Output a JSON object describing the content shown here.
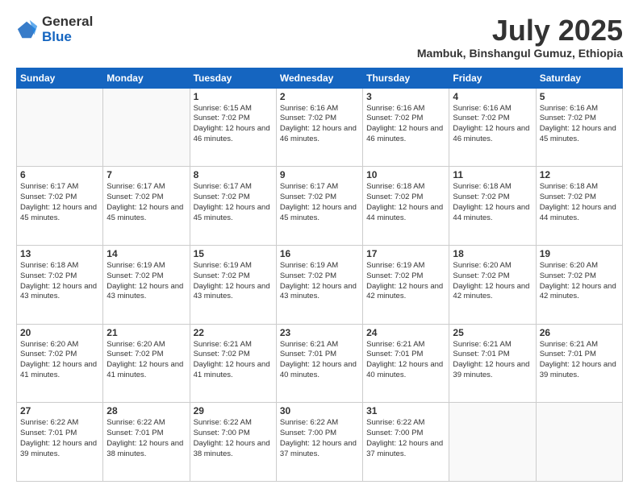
{
  "logo": {
    "general": "General",
    "blue": "Blue"
  },
  "title": "July 2025",
  "subtitle": "Mambuk, Binshangul Gumuz, Ethiopia",
  "days_of_week": [
    "Sunday",
    "Monday",
    "Tuesday",
    "Wednesday",
    "Thursday",
    "Friday",
    "Saturday"
  ],
  "weeks": [
    [
      {
        "day": "",
        "info": ""
      },
      {
        "day": "",
        "info": ""
      },
      {
        "day": "1",
        "info": "Sunrise: 6:15 AM\nSunset: 7:02 PM\nDaylight: 12 hours and 46 minutes."
      },
      {
        "day": "2",
        "info": "Sunrise: 6:16 AM\nSunset: 7:02 PM\nDaylight: 12 hours and 46 minutes."
      },
      {
        "day": "3",
        "info": "Sunrise: 6:16 AM\nSunset: 7:02 PM\nDaylight: 12 hours and 46 minutes."
      },
      {
        "day": "4",
        "info": "Sunrise: 6:16 AM\nSunset: 7:02 PM\nDaylight: 12 hours and 46 minutes."
      },
      {
        "day": "5",
        "info": "Sunrise: 6:16 AM\nSunset: 7:02 PM\nDaylight: 12 hours and 45 minutes."
      }
    ],
    [
      {
        "day": "6",
        "info": "Sunrise: 6:17 AM\nSunset: 7:02 PM\nDaylight: 12 hours and 45 minutes."
      },
      {
        "day": "7",
        "info": "Sunrise: 6:17 AM\nSunset: 7:02 PM\nDaylight: 12 hours and 45 minutes."
      },
      {
        "day": "8",
        "info": "Sunrise: 6:17 AM\nSunset: 7:02 PM\nDaylight: 12 hours and 45 minutes."
      },
      {
        "day": "9",
        "info": "Sunrise: 6:17 AM\nSunset: 7:02 PM\nDaylight: 12 hours and 45 minutes."
      },
      {
        "day": "10",
        "info": "Sunrise: 6:18 AM\nSunset: 7:02 PM\nDaylight: 12 hours and 44 minutes."
      },
      {
        "day": "11",
        "info": "Sunrise: 6:18 AM\nSunset: 7:02 PM\nDaylight: 12 hours and 44 minutes."
      },
      {
        "day": "12",
        "info": "Sunrise: 6:18 AM\nSunset: 7:02 PM\nDaylight: 12 hours and 44 minutes."
      }
    ],
    [
      {
        "day": "13",
        "info": "Sunrise: 6:18 AM\nSunset: 7:02 PM\nDaylight: 12 hours and 43 minutes."
      },
      {
        "day": "14",
        "info": "Sunrise: 6:19 AM\nSunset: 7:02 PM\nDaylight: 12 hours and 43 minutes."
      },
      {
        "day": "15",
        "info": "Sunrise: 6:19 AM\nSunset: 7:02 PM\nDaylight: 12 hours and 43 minutes."
      },
      {
        "day": "16",
        "info": "Sunrise: 6:19 AM\nSunset: 7:02 PM\nDaylight: 12 hours and 43 minutes."
      },
      {
        "day": "17",
        "info": "Sunrise: 6:19 AM\nSunset: 7:02 PM\nDaylight: 12 hours and 42 minutes."
      },
      {
        "day": "18",
        "info": "Sunrise: 6:20 AM\nSunset: 7:02 PM\nDaylight: 12 hours and 42 minutes."
      },
      {
        "day": "19",
        "info": "Sunrise: 6:20 AM\nSunset: 7:02 PM\nDaylight: 12 hours and 42 minutes."
      }
    ],
    [
      {
        "day": "20",
        "info": "Sunrise: 6:20 AM\nSunset: 7:02 PM\nDaylight: 12 hours and 41 minutes."
      },
      {
        "day": "21",
        "info": "Sunrise: 6:20 AM\nSunset: 7:02 PM\nDaylight: 12 hours and 41 minutes."
      },
      {
        "day": "22",
        "info": "Sunrise: 6:21 AM\nSunset: 7:02 PM\nDaylight: 12 hours and 41 minutes."
      },
      {
        "day": "23",
        "info": "Sunrise: 6:21 AM\nSunset: 7:01 PM\nDaylight: 12 hours and 40 minutes."
      },
      {
        "day": "24",
        "info": "Sunrise: 6:21 AM\nSunset: 7:01 PM\nDaylight: 12 hours and 40 minutes."
      },
      {
        "day": "25",
        "info": "Sunrise: 6:21 AM\nSunset: 7:01 PM\nDaylight: 12 hours and 39 minutes."
      },
      {
        "day": "26",
        "info": "Sunrise: 6:21 AM\nSunset: 7:01 PM\nDaylight: 12 hours and 39 minutes."
      }
    ],
    [
      {
        "day": "27",
        "info": "Sunrise: 6:22 AM\nSunset: 7:01 PM\nDaylight: 12 hours and 39 minutes."
      },
      {
        "day": "28",
        "info": "Sunrise: 6:22 AM\nSunset: 7:01 PM\nDaylight: 12 hours and 38 minutes."
      },
      {
        "day": "29",
        "info": "Sunrise: 6:22 AM\nSunset: 7:00 PM\nDaylight: 12 hours and 38 minutes."
      },
      {
        "day": "30",
        "info": "Sunrise: 6:22 AM\nSunset: 7:00 PM\nDaylight: 12 hours and 37 minutes."
      },
      {
        "day": "31",
        "info": "Sunrise: 6:22 AM\nSunset: 7:00 PM\nDaylight: 12 hours and 37 minutes."
      },
      {
        "day": "",
        "info": ""
      },
      {
        "day": "",
        "info": ""
      }
    ]
  ]
}
